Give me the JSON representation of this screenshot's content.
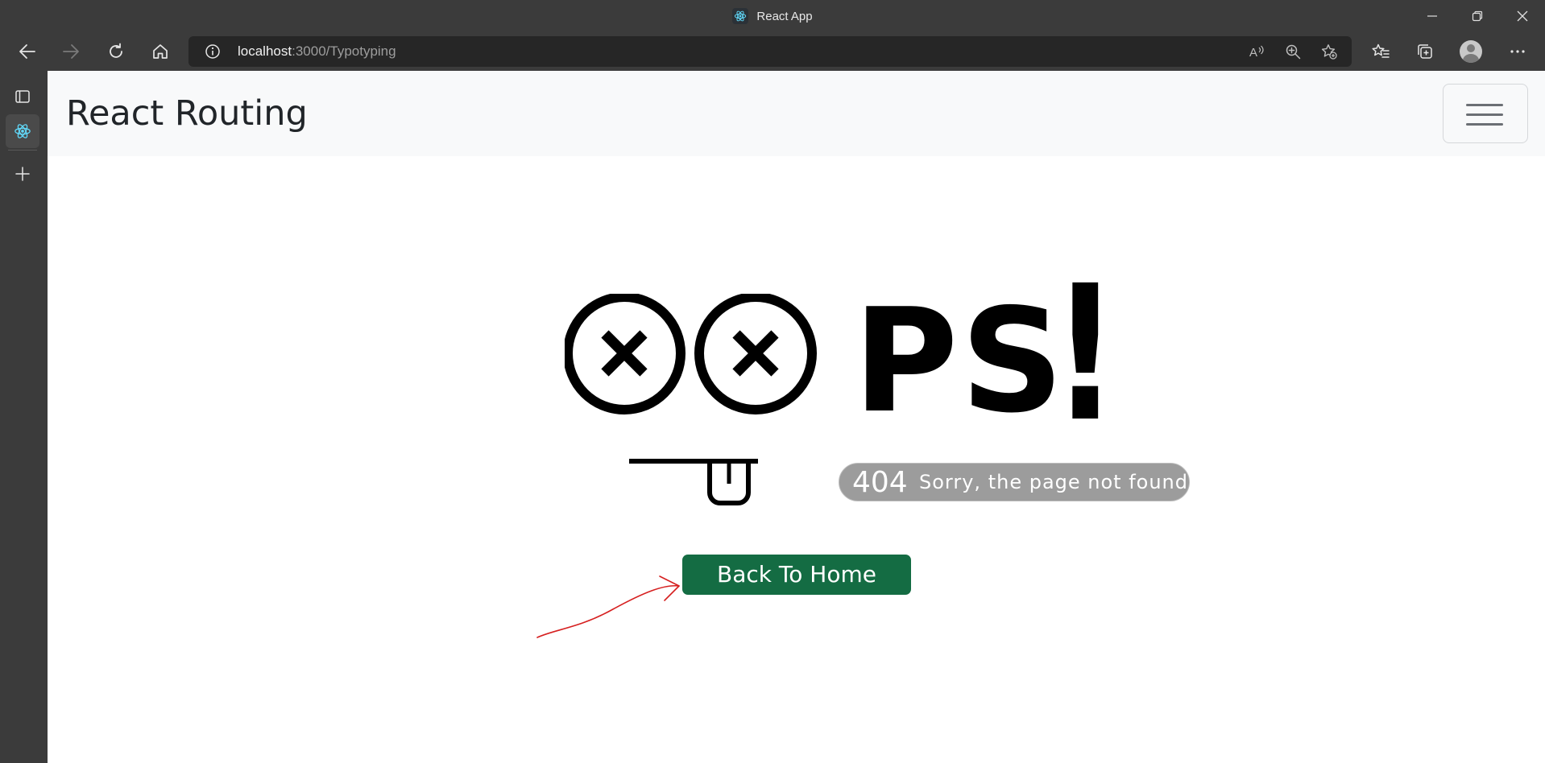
{
  "window": {
    "title": "React App",
    "tab_icon": "react-icon"
  },
  "toolbar": {
    "url_host": "localhost",
    "url_path": ":3000/Typotyping",
    "icons": [
      "back-icon",
      "forward-icon",
      "refresh-icon",
      "home-icon",
      "site-info-icon",
      "read-aloud-icon",
      "zoom-icon",
      "add-favorite-icon",
      "favorites-icon",
      "collections-icon",
      "profile-icon",
      "more-icon"
    ]
  },
  "sidebar": {
    "icons": [
      "tab-actions-icon",
      "react-icon",
      "new-tab-icon"
    ]
  },
  "page": {
    "brand": "React Routing",
    "oops_word": "PS",
    "oops_bang": "!",
    "error_code": "404",
    "error_message": "Sorry, the page not found",
    "back_button": "Back To Home"
  },
  "colors": {
    "button_bg": "#146c43",
    "annotation_arrow": "#d62020",
    "navbar_bg": "#f8f9fa"
  }
}
